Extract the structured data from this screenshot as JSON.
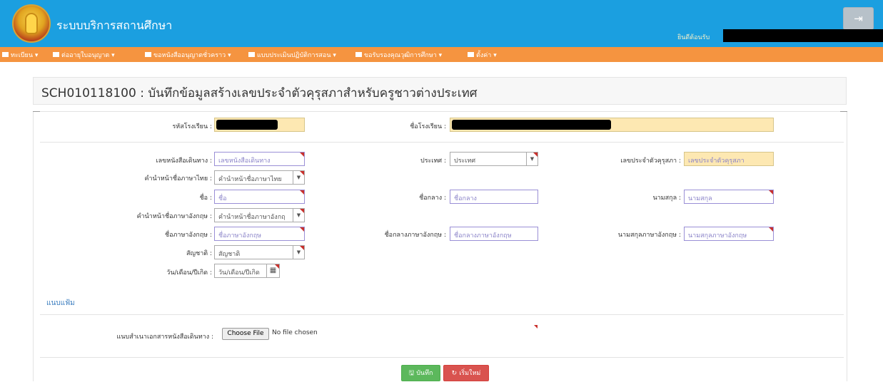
{
  "header": {
    "app_title": "ระบบบริการสถานศึกษา",
    "welcome_label": "ยินดีต้อนรับ",
    "logout_icon": "logout-icon"
  },
  "nav": {
    "items": [
      {
        "label": "ทะเบียน"
      },
      {
        "label": "ต่ออายุใบอนุญาต"
      },
      {
        "label": "ขอหนังสืออนุญาตชั่วคราว"
      },
      {
        "label": "แบบประเมินปฏิบัติการสอน"
      },
      {
        "label": "ขอรับรองคุณวุฒิการศึกษา"
      },
      {
        "label": "ตั้งค่า"
      }
    ]
  },
  "page": {
    "title": "SCH010118100 : บันทึกข้อมูลสร้างเลขประจำตัวคุรุสภาสำหรับครูชาวต่างประเทศ"
  },
  "form": {
    "school_code_label": "รหัสโรงเรียน :",
    "school_name_label": "ชื่อโรงเรียน :",
    "passport_label": "เลขหนังสือเดินทาง :",
    "passport_placeholder": "เลขหนังสือเดินทาง",
    "country_label": "ประเทศ :",
    "country_value": "ประเทศ",
    "kurusapa_id_label": "เลขประจำตัวคุรุสภา :",
    "kurusapa_id_placeholder": "เลขประจำตัวคุรุสภา",
    "thai_prefix_label": "คำนำหน้าชื่อภาษาไทย :",
    "thai_prefix_value": "คำนำหน้าชื่อภาษาไทย",
    "first_name_label": "ชื่อ :",
    "first_name_placeholder": "ชื่อ",
    "middle_name_label": "ชื่อกลาง :",
    "middle_name_placeholder": "ชื่อกลาง",
    "last_name_label": "นามสกุล :",
    "last_name_placeholder": "นามสกุล",
    "en_prefix_label": "คำนำหน้าชื่อภาษาอังกฤษ :",
    "en_prefix_value": "คำนำหน้าชื่อภาษาอังกฤ",
    "en_first_name_label": "ชื่อภาษาอังกฤษ :",
    "en_first_name_placeholder": "ชื่อภาษาอังกฤษ",
    "en_middle_name_label": "ชื่อกลางภาษาอังกฤษ :",
    "en_middle_name_placeholder": "ชื่อกลางภาษาอังกฤษ",
    "en_last_name_label": "นามสกุลภาษาอังกฤษ :",
    "en_last_name_placeholder": "นามสกุลภาษาอังกฤษ",
    "nationality_label": "สัญชาติ :",
    "nationality_value": "สัญชาติ",
    "dob_label": "วัน/เดือน/ปีเกิด :",
    "dob_placeholder": "วัน/เดือน/ปีเกิด"
  },
  "attachments": {
    "section_title": "แนบแฟ้ม",
    "passport_copy_label": "แนบสำเนาเอกสารหนังสือเดินทาง :",
    "choose_file_label": "Choose File",
    "file_status": "No file chosen"
  },
  "actions": {
    "save_label": "บันทึก",
    "reset_label": "เริ่มใหม่"
  }
}
